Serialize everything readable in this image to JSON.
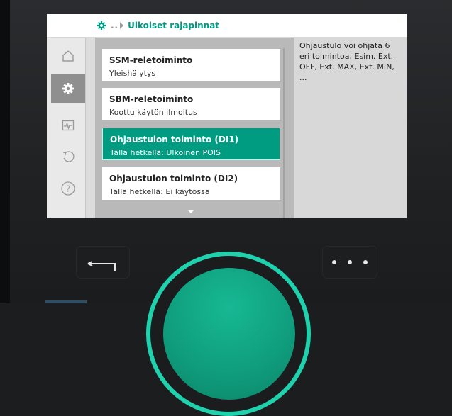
{
  "header": {
    "breadcrumb_dots": "..",
    "title": "Ulkoiset rajapinnat"
  },
  "sidebar": {
    "items": [
      {
        "icon": "home-icon"
      },
      {
        "icon": "gear-icon",
        "active": true
      },
      {
        "icon": "diagnostics-icon"
      },
      {
        "icon": "undo-icon"
      },
      {
        "icon": "help-icon"
      }
    ]
  },
  "menu": {
    "items": [
      {
        "title": "SSM-reletoiminto",
        "subtitle": "Yleishälytys"
      },
      {
        "title": "SBM-reletoiminto",
        "subtitle": "Koottu käytön ilmoitus"
      },
      {
        "title": "Ohjaustulon toiminto (DI1)",
        "subtitle": "Tällä hetkellä: Ulkoinen POIS",
        "selected": true
      },
      {
        "title": "Ohjaustulon toiminto (DI2)",
        "subtitle": "Tällä hetkellä: Ei käytössä"
      }
    ]
  },
  "info_panel": {
    "text": "Ohjaustulo voi ohjata 6 eri toimintoa. Esim. Ext. OFF, Ext. MAX, Ext. MIN, ..."
  },
  "colors": {
    "accent": "#009c82",
    "knob_ring": "#1fd1ad"
  }
}
